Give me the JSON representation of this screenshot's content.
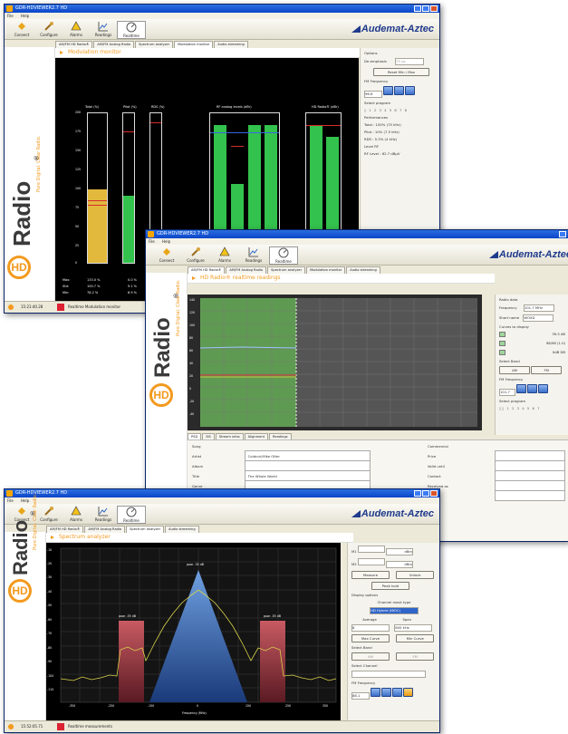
{
  "modulation_window": {
    "title": "GDR-HDVIEWER2.7 HD",
    "menu": [
      "File",
      "Help"
    ],
    "toolbar": [
      "Connect",
      "Configure",
      "Alarms",
      "Readings",
      "Realtime"
    ],
    "logo": "Audemat-Aztec",
    "tabs": [
      "AM/FM HD Radio®",
      "AM/FM Analog Radio",
      "Spectrum analyzer",
      "Modulation monitor",
      "Audio streaming"
    ],
    "active_tab": 3,
    "panel_title": "Modulation monitor",
    "meter_titles": [
      "Total (%)",
      "Pilot (%)",
      "RDS (%)",
      "RF analog levels (dBr)",
      "HD Radio® (dBr)"
    ],
    "total_ticks": [
      "200",
      "175",
      "150",
      "125",
      "100",
      "75",
      "50",
      "25",
      "0"
    ],
    "stats": {
      "labels": [
        "Max:",
        "Std:",
        "Min:"
      ],
      "total": [
        "133.0 %",
        "100.7 %",
        "78.2 %"
      ],
      "pilot": [
        "0.0 %",
        "9.1 %",
        "8.9 %"
      ]
    },
    "right_panel": {
      "options_label": "Options",
      "de_emphasis_label": "De-emphasis",
      "de_emphasis_value": "75 µs",
      "reset_button": "Reset Min / Max",
      "fm_frequency_label": "FM Frequency",
      "fm_frequency_value": "96.6",
      "select_program_label": "Select program",
      "performances_label": "Performances",
      "perf_lines": [
        "Total : 100% (75 kHz)",
        "Pilot : 10% (7.5 kHz)",
        "RDS : 5.3% (4 kHz)"
      ],
      "level_label": "Level RF",
      "level_value": "RF Level : 62.7 dBµV"
    },
    "status_time": "15:21:40.28",
    "status_msg": "Realtime Modulation monitor"
  },
  "readings_window": {
    "title": "GDR-HDVIEWER2.7 HD",
    "menu": [
      "File",
      "Help"
    ],
    "toolbar": [
      "Connect",
      "Configure",
      "Alarms",
      "Readings",
      "Realtime"
    ],
    "logo": "Audemat-Aztec",
    "tabs": [
      "AM/FM HD Radio®",
      "AM/FM Analog Radio",
      "Spectrum analyzer",
      "Modulation monitor",
      "Audio streaming"
    ],
    "active_tab": 0,
    "panel_title": "HD Radio® realtime readings",
    "y_ticks": [
      "140",
      "120",
      "100",
      "80",
      "60",
      "40",
      "20",
      "0",
      "-20",
      "-40"
    ],
    "sub_tabs": [
      "PSD",
      "SIS",
      "Stream infos",
      "Alignment",
      "Readings"
    ],
    "psd_labels": [
      "Song",
      "Artist",
      "Album",
      "Title",
      "Genre"
    ],
    "psd_values": [
      "",
      "Coldcut;Mike Ofter",
      "",
      "The Whole World",
      ""
    ],
    "commercial_labels": [
      "Commercial",
      "Price",
      "Valid until",
      "Contact",
      "Received as",
      "Seller"
    ],
    "right_panel": {
      "radio_data_label": "Radio data",
      "frequency_label": "Frequency",
      "frequency_value": "101.7 MHz",
      "short_name_label": "Short name",
      "short_name_value": "WOXD",
      "curves_label": "Curves to display",
      "curve_values": [
        "39.5 dB",
        "98/98 (1.0)",
        "0dB DB"
      ],
      "select_band_label": "Select Band",
      "bands": [
        "AM",
        "FM"
      ],
      "fm_frequency_label": "FM Frequency",
      "fm_frequency_value": "101.7",
      "select_program_label": "Select program"
    }
  },
  "spectrum_window": {
    "title": "GDR-HDVIEWER2.7 HD",
    "menu": [
      "File",
      "Help"
    ],
    "toolbar": [
      "Connect",
      "Configure",
      "Alarms",
      "Readings",
      "Realtime"
    ],
    "logo": "Audemat-Aztec",
    "tabs": [
      "AM/FM HD Radio®",
      "AM/FM Analog Radio",
      "Spectrum analyzer",
      "Audio streaming"
    ],
    "active_tab": 2,
    "panel_title": "Spectrum analyzer",
    "x_axis_label": "Frequency (MHz)",
    "x_ticks": [
      "-350",
      "-300",
      "-250",
      "-200",
      "-150",
      "-100",
      "-50",
      "0",
      "50",
      "100",
      "150",
      "200",
      "250",
      "300",
      "350"
    ],
    "y_ticks": [
      "-10",
      "-20",
      "-30",
      "-40",
      "-50",
      "-60",
      "-70",
      "-80",
      "-90",
      "-100",
      "-110"
    ],
    "peak_labels": [
      "pow: -55 dB",
      "pow: -35 dB",
      "pow: -55 dB"
    ],
    "right_panel": {
      "markers": [
        {
          "label": "M1",
          "freq": "",
          "level": "dBm"
        },
        {
          "label": "M2",
          "freq": "",
          "level": "dBm"
        }
      ],
      "buttons": [
        "Measure",
        "Unlock",
        "Peak hold"
      ],
      "display_options_label": "Display options",
      "channel_mask_label": "Channel mask type",
      "channel_mask_value": "HD Hybrid (IBOC)",
      "average_label": "Average",
      "span_label": "Span",
      "average_value": "8",
      "span_value": "800 kHz",
      "max_curve": "Max Curve",
      "min_curve": "Min Curve",
      "select_band_label": "Select Band",
      "bands": [
        "AM",
        "FM"
      ],
      "select_channel_label": "Select Channel",
      "fm_frequency_label": "FM Frequency",
      "fm_frequency_value": "88.1"
    },
    "status_time": "15:52:05.71",
    "status_msg": "Realtime measurements"
  },
  "brand": {
    "hd": "HD",
    "radio": "Radio",
    "reg": "®",
    "tagline": "Pure Digital. Clear Radio."
  },
  "colors": {
    "orange": "#f39a1e",
    "meter_yellow": "#e2b93c",
    "meter_green": "#33c24d",
    "chart_green": "#5f9a52",
    "spectrum_red": "#b54a52",
    "spectrum_blue": "#3a6fb0",
    "spectrum_line": "#d9d34c"
  }
}
